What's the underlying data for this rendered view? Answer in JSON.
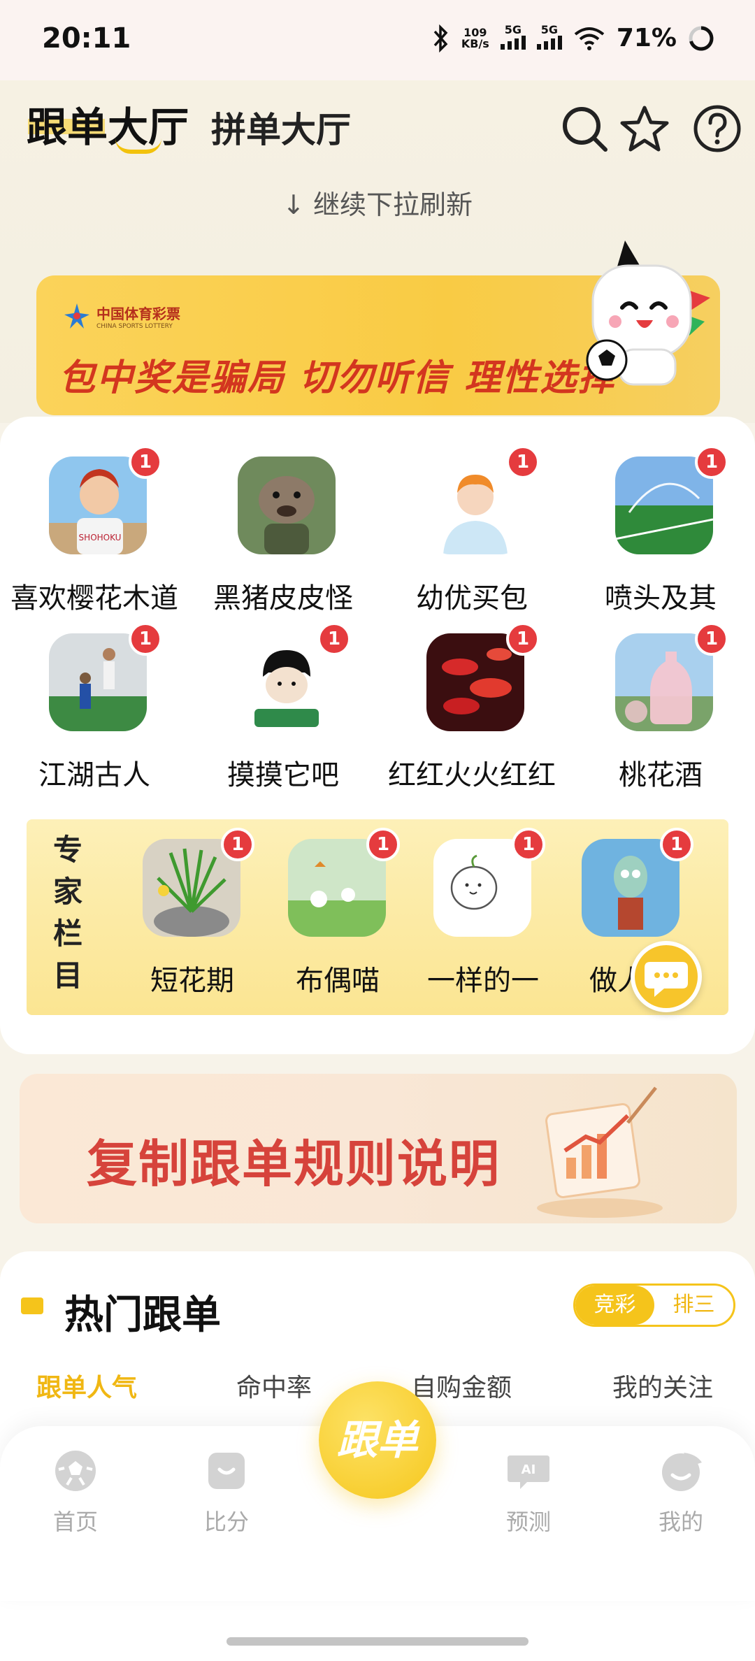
{
  "status_bar": {
    "time": "20:11",
    "net_speed_value": "109",
    "net_speed_unit": "KB/s",
    "signal1": "5G",
    "signal2": "5G",
    "battery": "71%"
  },
  "header": {
    "tab_active": "跟单大厅",
    "tab_other": "拼单大厅",
    "pull_hint": "继续下拉刷新",
    "icons": [
      "search-icon",
      "star-icon",
      "help-icon"
    ]
  },
  "banner_top": {
    "logo_cn": "中国体育彩票",
    "logo_en": "CHINA SPORTS LOTTERY",
    "slogan": "包中奖是骗局  切勿听信  理性选择"
  },
  "users": [
    {
      "name": "喜欢樱花木道",
      "badge": "1"
    },
    {
      "name": "黑猪皮皮怪",
      "badge": ""
    },
    {
      "name": "幼优买包",
      "badge": "1"
    },
    {
      "name": "喷头及其",
      "badge": "1"
    },
    {
      "name": "江湖古人",
      "badge": "1"
    },
    {
      "name": "摸摸它吧",
      "badge": "1"
    },
    {
      "name": "红红火火红红",
      "badge": "1"
    },
    {
      "name": "桃花酒",
      "badge": "1"
    }
  ],
  "expert": {
    "label": "专家栏目",
    "items": [
      {
        "name": "短花期",
        "badge": "1"
      },
      {
        "name": "布偶喵",
        "badge": "1"
      },
      {
        "name": "一样的一",
        "badge": "1"
      },
      {
        "name": "做人要",
        "badge": "1"
      }
    ]
  },
  "banner_copy": {
    "text": "复制跟单规则说明"
  },
  "hot": {
    "title": "热门跟单",
    "segment": [
      "竞彩",
      "排三"
    ],
    "sort_tabs": [
      "跟单人气",
      "命中率",
      "自购金额",
      "我的关注"
    ]
  },
  "nav": {
    "items": [
      {
        "label": "首页",
        "icon": "football-icon"
      },
      {
        "label": "比分",
        "icon": "score-bag-icon"
      },
      {
        "label": "预测",
        "icon": "ai-chat-icon"
      },
      {
        "label": "我的",
        "icon": "profile-icon"
      }
    ],
    "center_label": "跟单"
  },
  "colors": {
    "accent": "#f5c41b",
    "badge": "#e53b3e",
    "warning_text": "#d3361f"
  }
}
